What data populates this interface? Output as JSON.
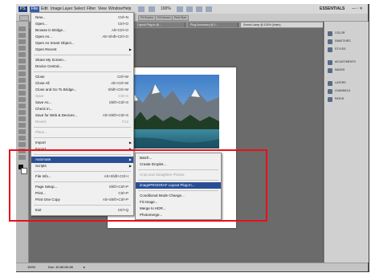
{
  "menubar": {
    "items": [
      "PS",
      "File",
      "Edit",
      "Image",
      "Layer",
      "Select",
      "Filter",
      "View",
      "Window",
      "Help"
    ],
    "zoom": "100%",
    "workspace": "ESSENTIALS"
  },
  "options": {
    "buttons": [
      "Fit Screen",
      "Fill Screen",
      "Print Size"
    ]
  },
  "tabs": [
    "Untitled-1 @ 100% ...",
    "Scenicsalt @ 100%...",
    "Layout Plug-in @...",
    "Plug-Accessory @ 1...",
    "Scenic Lamp @ 100% (Index)"
  ],
  "file_menu": [
    {
      "label": "New...",
      "shortcut": "Ctrl+N"
    },
    {
      "label": "Open...",
      "shortcut": "Ctrl+O"
    },
    {
      "label": "Browse in Bridge...",
      "shortcut": "Alt+Ctrl+O"
    },
    {
      "label": "Open As...",
      "shortcut": "Alt+Shift+Ctrl+O"
    },
    {
      "label": "Open As Smart Object...",
      "shortcut": ""
    },
    {
      "label": "Open Recent",
      "shortcut": ""
    },
    {
      "label": "Share My Screen...",
      "shortcut": ""
    },
    {
      "label": "Device Central...",
      "shortcut": ""
    },
    {
      "label": "Close",
      "shortcut": "Ctrl+W"
    },
    {
      "label": "Close All",
      "shortcut": "Alt+Ctrl+W"
    },
    {
      "label": "Close and Go To Bridge...",
      "shortcut": "Shift+Ctrl+W"
    },
    {
      "label": "Save",
      "shortcut": "Ctrl+S"
    },
    {
      "label": "Save As...",
      "shortcut": "Shift+Ctrl+S"
    },
    {
      "label": "Check In...",
      "shortcut": ""
    },
    {
      "label": "Save for Web & Devices...",
      "shortcut": "Alt+Shift+Ctrl+S"
    },
    {
      "label": "Revert",
      "shortcut": "F12"
    },
    {
      "label": "Place...",
      "shortcut": ""
    },
    {
      "label": "Import",
      "shortcut": ""
    },
    {
      "label": "Export",
      "shortcut": ""
    },
    {
      "label": "Automate",
      "shortcut": ""
    },
    {
      "label": "Scripts",
      "shortcut": ""
    },
    {
      "label": "File Info...",
      "shortcut": "Alt+Shift+Ctrl+I"
    },
    {
      "label": "Page Setup...",
      "shortcut": "Shift+Ctrl+P"
    },
    {
      "label": "Print...",
      "shortcut": "Ctrl+P"
    },
    {
      "label": "Print One Copy",
      "shortcut": "Alt+Shift+Ctrl+P"
    },
    {
      "label": "Exit",
      "shortcut": "Ctrl+Q"
    }
  ],
  "automate_menu": [
    {
      "label": "Batch..."
    },
    {
      "label": "Create Droplet..."
    },
    {
      "label": "Crop and Straighten Photos"
    },
    {
      "label": "imagePROGRAF Layout Plug-In..."
    },
    {
      "label": "Conditional Mode Change..."
    },
    {
      "label": "Fit Image..."
    },
    {
      "label": "Merge to HDR..."
    },
    {
      "label": "Photomerge..."
    }
  ],
  "panels": [
    "COLOR",
    "SWATCHES",
    "STYLES",
    "ADJUSTMENTS",
    "MASKS",
    "LAYERS",
    "CHANNELS",
    "PATHS"
  ],
  "status": {
    "zoom": "100%",
    "doc": "Doc: 40.6K/40.6K"
  },
  "colors": {
    "highlight": "#2a4e96",
    "callout": "#e8101a"
  }
}
